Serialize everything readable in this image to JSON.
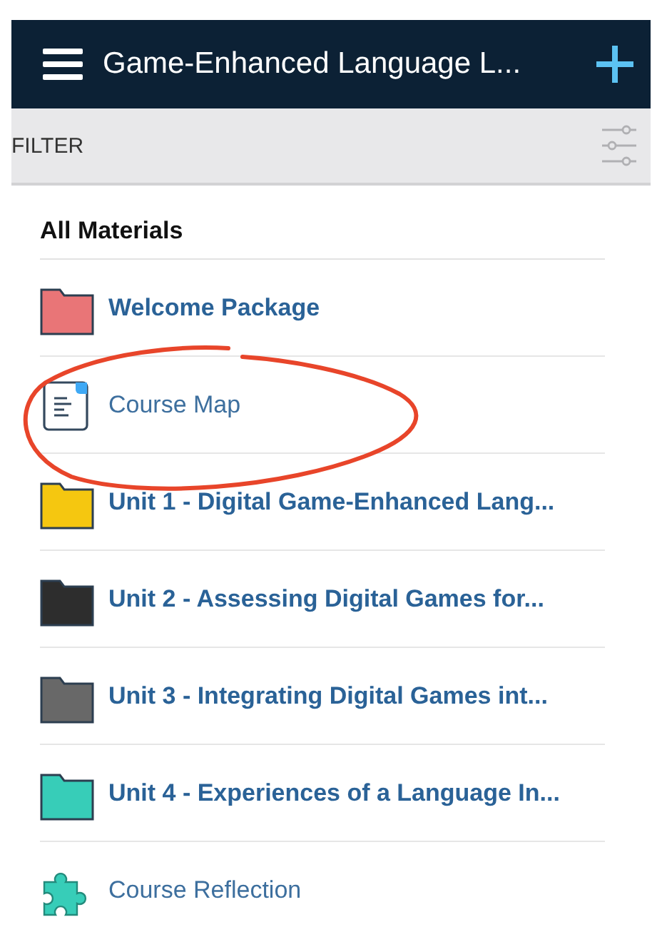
{
  "header": {
    "title": "Game-Enhanced Language L..."
  },
  "filter": {
    "label": "FILTER"
  },
  "section": {
    "title": "All Materials"
  },
  "items": [
    {
      "kind": "folder",
      "label": "Welcome Package",
      "color": "#e97577"
    },
    {
      "kind": "document",
      "label": "Course Map"
    },
    {
      "kind": "folder",
      "label": "Unit 1 - Digital Game-Enhanced Lang...",
      "color": "#f5c710"
    },
    {
      "kind": "folder",
      "label": "Unit 2 - Assessing Digital Games for...",
      "color": "#2d2d2d"
    },
    {
      "kind": "folder",
      "label": "Unit 3 - Integrating Digital Games int...",
      "color": "#686868"
    },
    {
      "kind": "folder",
      "label": "Unit 4 - Experiences of a Language In...",
      "color": "#37cdb8"
    },
    {
      "kind": "puzzle",
      "label": "Course Reflection"
    }
  ]
}
